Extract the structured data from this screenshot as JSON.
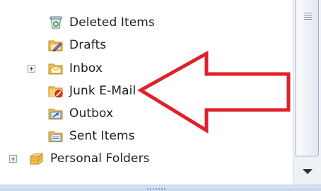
{
  "folders": [
    {
      "label": "Deleted Items",
      "icon": "recycle-bin-icon"
    },
    {
      "label": "Drafts",
      "icon": "drafts-folder-icon"
    },
    {
      "label": "Inbox",
      "icon": "inbox-folder-icon",
      "expandable": true
    },
    {
      "label": "Junk E-Mail",
      "icon": "junk-folder-icon"
    },
    {
      "label": "Outbox",
      "icon": "outbox-folder-icon"
    },
    {
      "label": "Sent Items",
      "icon": "sent-folder-icon"
    },
    {
      "label": "Personal Folders",
      "icon": "personal-folders-icon",
      "expandable": true
    }
  ],
  "annotation": {
    "type": "arrow",
    "color": "#e0202a",
    "points_to": "Junk E-Mail"
  },
  "colors": {
    "text": "#1e1e1e",
    "folder": "#f2c04c",
    "scrollbar": "#eef1f5",
    "splitter": "#c4d6ec"
  }
}
